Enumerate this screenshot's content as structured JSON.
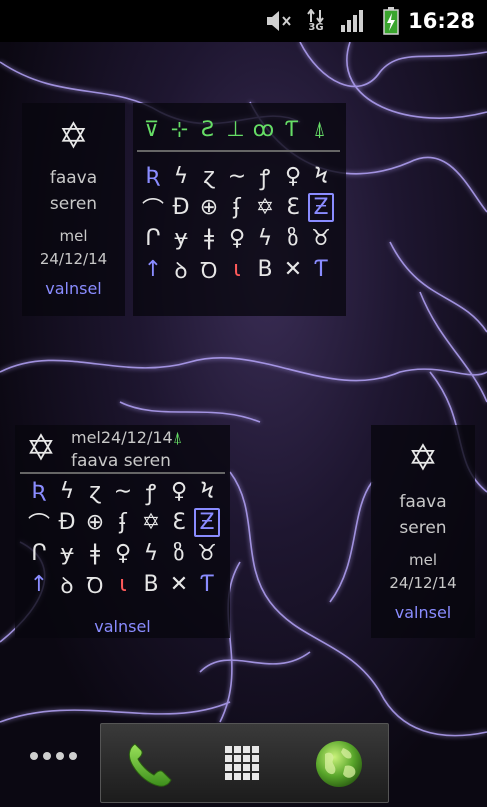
{
  "status_bar": {
    "time": "16:28",
    "network_type": "3G",
    "icons": [
      "mute-icon",
      "data-3g-icon",
      "signal-icon",
      "battery-charging-icon"
    ]
  },
  "widget_a": {
    "symbol": "✡",
    "word1": "faava",
    "word2": "seren",
    "label": "mel",
    "date": "24/12/14",
    "link": "valnsel"
  },
  "widget_b": {
    "header": [
      "⊽",
      "⊹",
      "Ƨ",
      "⊥",
      "ꝏ",
      "Ƭ",
      "⍋"
    ],
    "rows": [
      [
        "Ʀ",
        "ϟ",
        "ɀ",
        "∼",
        "ꝭ",
        "♀",
        "Ϟ"
      ],
      [
        "⌒",
        "Ð",
        "⊕",
        "ʄ",
        "✡",
        "Ɛ",
        "Ƶ"
      ],
      [
        "Ր",
        "ɏ",
        "ǂ",
        "♀",
        "ϟ",
        "ზ",
        "♉"
      ],
      [
        "↑",
        "ꝺ",
        "Ꝺ",
        "ɩ",
        "B",
        "✕",
        "Ƭ"
      ]
    ]
  },
  "widget_c": {
    "symbol": "✡",
    "label_date": "mel24/12/14",
    "marker": "⍋",
    "words": "faava seren",
    "rows": [
      [
        "Ʀ",
        "ϟ",
        "ɀ",
        "∼",
        "ꝭ",
        "♀",
        "Ϟ"
      ],
      [
        "⌒",
        "Ð",
        "⊕",
        "ʄ",
        "✡",
        "Ɛ",
        "Ƶ"
      ],
      [
        "Ր",
        "ɏ",
        "ǂ",
        "♀",
        "ϟ",
        "ზ",
        "♉"
      ],
      [
        "↑",
        "ꝺ",
        "Ꝺ",
        "ɩ",
        "B",
        "✕",
        "Ƭ"
      ]
    ],
    "link": "valnsel"
  },
  "widget_d": {
    "symbol": "✡",
    "word1": "faava",
    "word2": "seren",
    "label": "mel",
    "date": "24/12/14",
    "link": "valnsel"
  },
  "dock": {
    "items": [
      "phone-icon",
      "app-drawer-icon",
      "browser-globe-icon"
    ]
  },
  "colors": {
    "accent_blue": "#8a8cff",
    "accent_green": "#66dd66",
    "accent_red": "#ff5a5a"
  }
}
